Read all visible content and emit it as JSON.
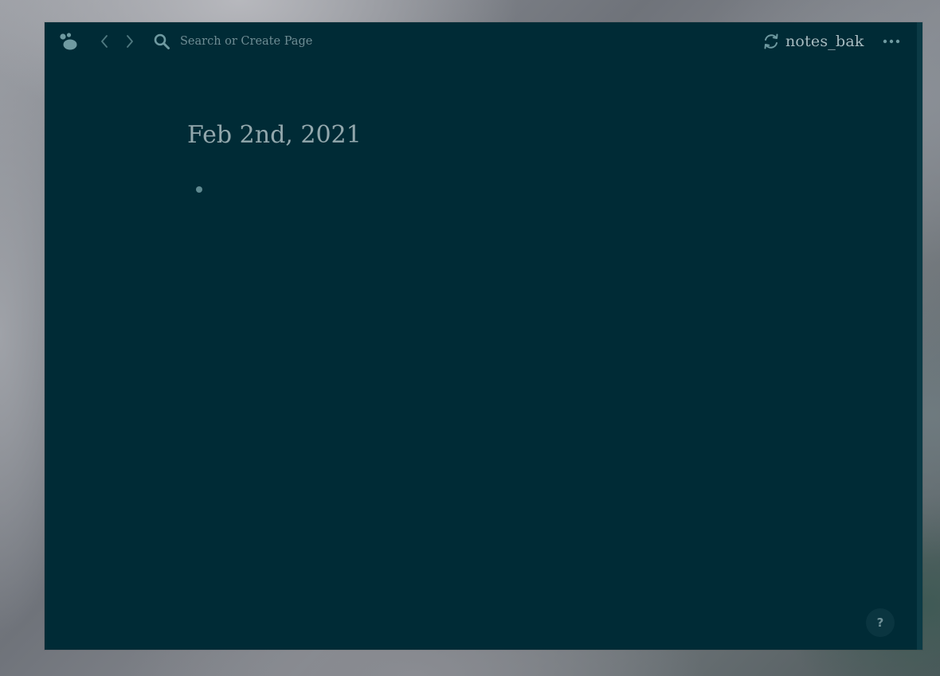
{
  "colors": {
    "window_background": "#002b36",
    "icon": "#6f9aa1",
    "title_text": "#93a8ad",
    "repo_text": "#a7bbc0"
  },
  "header": {
    "logo_icon": "logseq-logo-icon",
    "back_icon": "chevron-left-icon",
    "forward_icon": "chevron-right-icon",
    "search": {
      "icon": "search-icon",
      "placeholder": "Search or Create Page",
      "value": ""
    },
    "repo": {
      "icon": "sync-icon",
      "label": "notes_bak"
    },
    "more_icon": "more-horizontal-icon"
  },
  "main": {
    "page_title": "Feb 2nd, 2021",
    "blocks": [
      {
        "content": ""
      }
    ]
  },
  "help": {
    "label": "?"
  }
}
